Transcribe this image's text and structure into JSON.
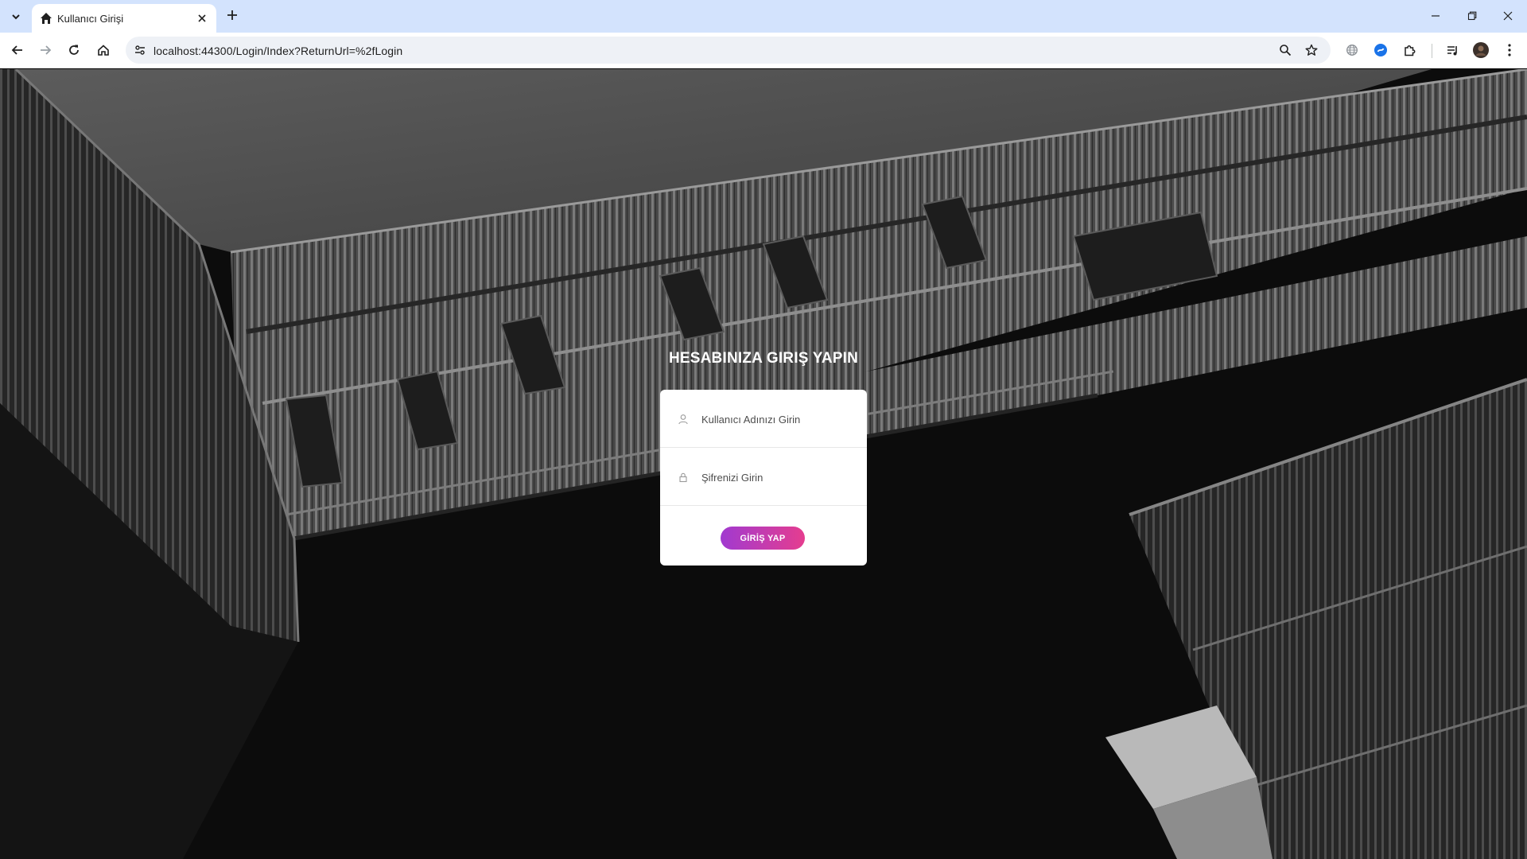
{
  "browser": {
    "tab": {
      "title": "Kullanıcı Girişi",
      "favicon": "home-icon"
    },
    "url": "localhost:44300/Login/Index?ReturnUrl=%2fLogin",
    "toolbar_icons": [
      "back-icon",
      "forward-icon",
      "reload-icon",
      "home-icon",
      "zoom-icon",
      "bookmark-star-icon",
      "globe-icon",
      "extension-icon",
      "puzzle-icon",
      "media-icon",
      "avatar",
      "menu-icon"
    ],
    "window_controls": [
      "minimize-icon",
      "restore-icon",
      "close-icon"
    ]
  },
  "login": {
    "title": "HESABINIZA GIRIŞ YAPIN",
    "username_placeholder": "Kullanıcı Adınızı Girin",
    "password_placeholder": "Şifrenizi Girin",
    "submit_label": "GİRİŞ YAP"
  },
  "colors": {
    "button_gradient_start": "#a13ad0",
    "button_gradient_end": "#e53d8f",
    "tabbar": "#d3e3fd"
  }
}
